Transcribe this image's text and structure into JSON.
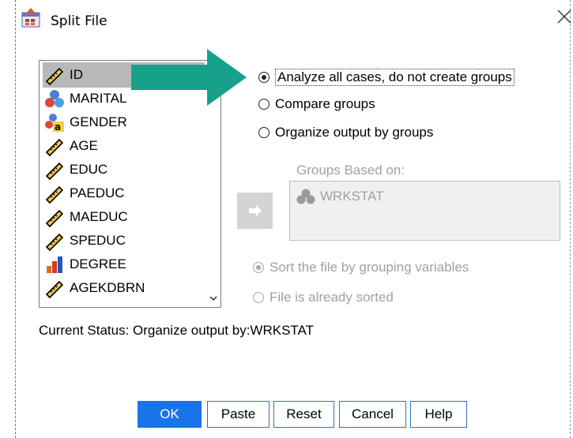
{
  "window": {
    "title": "Split File"
  },
  "variables": [
    {
      "label": "ID",
      "icon": "scale-ruler-icon",
      "selected": true
    },
    {
      "label": "MARITAL",
      "icon": "nominal-balls-icon"
    },
    {
      "label": "GENDER",
      "icon": "nominal-string-icon"
    },
    {
      "label": "AGE",
      "icon": "scale-ruler-icon"
    },
    {
      "label": "EDUC",
      "icon": "scale-ruler-icon"
    },
    {
      "label": "PAEDUC",
      "icon": "scale-ruler-icon"
    },
    {
      "label": "MAEDUC",
      "icon": "scale-ruler-icon"
    },
    {
      "label": "SPEDUC",
      "icon": "scale-ruler-icon"
    },
    {
      "label": "DEGREE",
      "icon": "ordinal-bars-icon"
    },
    {
      "label": "AGEKDBRN",
      "icon": "scale-ruler-icon"
    }
  ],
  "options": {
    "analyze_all": "Analyze all cases, do not create groups",
    "compare": "Compare groups",
    "organize": "Organize output by groups"
  },
  "groups": {
    "label": "Groups Based on:",
    "items": [
      "WRKSTAT"
    ]
  },
  "sort": {
    "by_grouping": "Sort the file by grouping variables",
    "already_sorted": "File is already sorted"
  },
  "status": "Current Status: Organize output by:WRKSTAT",
  "buttons": {
    "ok": "OK",
    "paste": "Paste",
    "reset": "Reset",
    "cancel": "Cancel",
    "help": "Help"
  },
  "colors": {
    "arrow": "#17a18a",
    "ok_button": "#1a73e8"
  }
}
